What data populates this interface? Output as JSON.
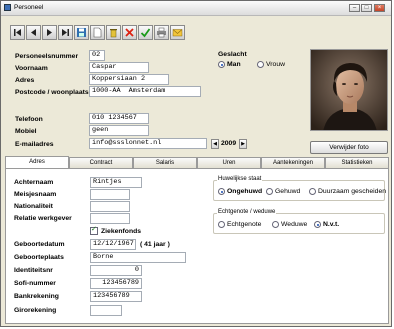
{
  "window": {
    "title": "Personeel"
  },
  "toolbar": {
    "buttons": [
      "first-record",
      "previous-record",
      "next-record",
      "last-record",
      "save",
      "new-record",
      "delete",
      "cancel",
      "check",
      "print",
      "mail"
    ]
  },
  "person": {
    "personeelsnummer": {
      "label": "Personeelsnummer",
      "value": "02"
    },
    "voornaam": {
      "label": "Voornaam",
      "value": "Caspar"
    },
    "adres": {
      "label": "Adres",
      "value": "Koppersiaan 2"
    },
    "postcode": {
      "label": "Postcode / woonplaats",
      "postcode": "1000-AA",
      "woonplaats": "Amsterdam"
    },
    "telefoon": {
      "label": "Telefoon",
      "value": "010 1234567"
    },
    "mobiel": {
      "label": "Mobiel",
      "value": "geen"
    },
    "email": {
      "label": "E-mailadres",
      "value": "info@ssslonnet.nl"
    }
  },
  "geslacht": {
    "label": "Geslacht",
    "man": "Man",
    "vrouw": "Vrouw",
    "selected": "Man"
  },
  "year_spinner": {
    "value": "2009"
  },
  "photo_button": {
    "label": "Verwijder foto"
  },
  "tabs": [
    "Adres",
    "Contract",
    "Salaris",
    "Uren",
    "Aantekeningen",
    "Statistieken"
  ],
  "active_tab": "Adres",
  "adres_tab": {
    "achternaam": {
      "label": "Achternaam",
      "value": "Rintjes"
    },
    "meisjesnaam": {
      "label": "Meisjesnaam",
      "value": ""
    },
    "nationaliteit": {
      "label": "Nationaliteit",
      "value": ""
    },
    "relatie": {
      "label": "Relatie werkgever",
      "value": ""
    },
    "ziekenfonds": {
      "label": "Ziekenfonds",
      "checked": true
    },
    "geboortedatum": {
      "label": "Geboortedatum",
      "value": "12/12/1967",
      "age": "( 41 jaar )"
    },
    "geboorteplaats": {
      "label": "Geboorteplaats",
      "value": "Borne"
    },
    "identiteitsnr": {
      "label": "Identiteitsnr",
      "value": "0"
    },
    "sofinummer": {
      "label": "Sofi-nummer",
      "value": "123456789"
    },
    "bankrekening": {
      "label": "Bankrekening",
      "value": "123456789"
    },
    "girorekening": {
      "label": "Girorekening",
      "value": ""
    }
  },
  "huwelijkse_staat": {
    "title": "Huwelijkse staat",
    "options": [
      "Ongehuwd",
      "Gehuwd",
      "Duurzaam gescheiden"
    ],
    "selected": "Ongehuwd"
  },
  "echtgenote": {
    "title": "Echtgenote / weduwe",
    "options": [
      "Echtgenote",
      "Weduwe",
      "N.v.t."
    ],
    "selected": "N.v.t."
  },
  "colors": {
    "accent": "#1a4fb3",
    "window_bg": "#ece9d8"
  }
}
